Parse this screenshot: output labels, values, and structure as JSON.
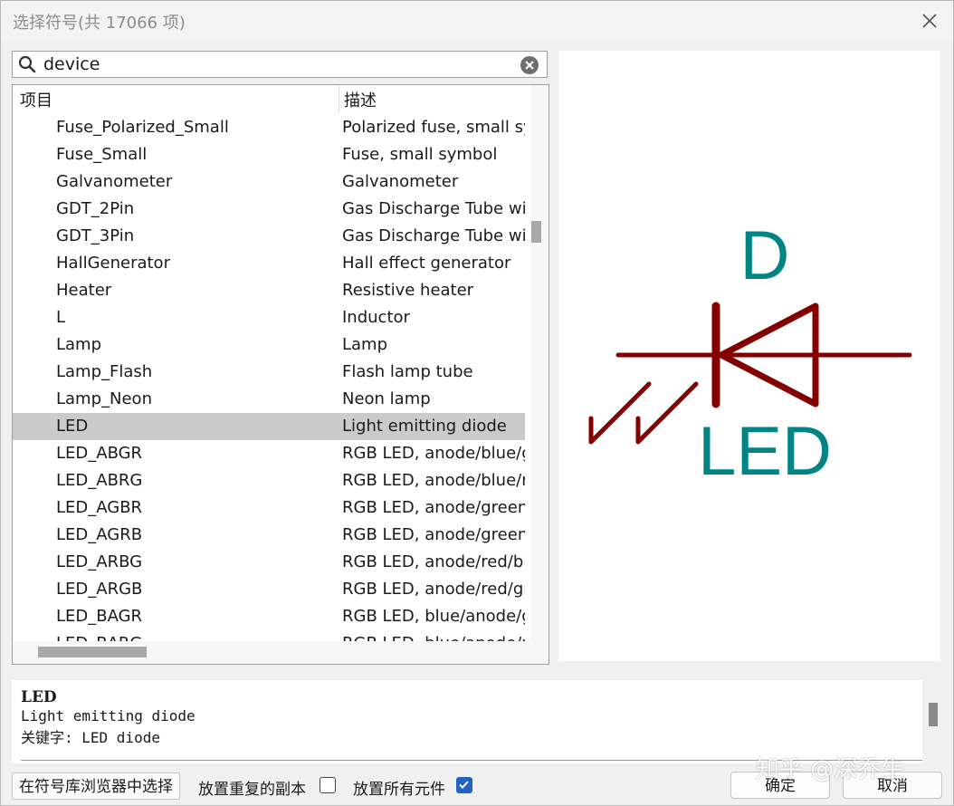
{
  "window": {
    "title": "选择符号(共 17066 项)",
    "close_icon": "close-icon"
  },
  "search": {
    "value": "device",
    "search_icon": "search-icon",
    "clear_icon": "clear-circle-icon"
  },
  "table": {
    "headers": [
      "项目",
      "描述"
    ],
    "rows": [
      {
        "name": "Fuse_Polarized_Small",
        "desc": "Polarized fuse, small syr"
      },
      {
        "name": "Fuse_Small",
        "desc": "Fuse, small symbol"
      },
      {
        "name": "Galvanometer",
        "desc": "Galvanometer"
      },
      {
        "name": "GDT_2Pin",
        "desc": "Gas Discharge Tube wit"
      },
      {
        "name": "GDT_3Pin",
        "desc": "Gas Discharge Tube wit"
      },
      {
        "name": "HallGenerator",
        "desc": "Hall effect generator"
      },
      {
        "name": "Heater",
        "desc": "Resistive heater"
      },
      {
        "name": "L",
        "desc": "Inductor"
      },
      {
        "name": "Lamp",
        "desc": "Lamp"
      },
      {
        "name": "Lamp_Flash",
        "desc": "Flash lamp tube"
      },
      {
        "name": "Lamp_Neon",
        "desc": "Neon lamp"
      },
      {
        "name": "LED",
        "desc": "Light emitting diode",
        "selected": true
      },
      {
        "name": "LED_ABGR",
        "desc": "RGB LED, anode/blue/g"
      },
      {
        "name": "LED_ABRG",
        "desc": "RGB LED, anode/blue/re"
      },
      {
        "name": "LED_AGBR",
        "desc": "RGB LED, anode/green/"
      },
      {
        "name": "LED_AGRB",
        "desc": "RGB LED, anode/green/"
      },
      {
        "name": "LED_ARBG",
        "desc": "RGB LED, anode/red/blu"
      },
      {
        "name": "LED_ARGB",
        "desc": "RGB LED, anode/red/gr"
      },
      {
        "name": "LED_BAGR",
        "desc": "RGB LED, blue/anode/g"
      },
      {
        "name": "LED_BARG",
        "desc": "RGB LED, blue/anode/r"
      }
    ]
  },
  "preview": {
    "reference": "D",
    "value": "LED",
    "symbol_color": "#840000",
    "text_color": "#008484"
  },
  "info": {
    "name": "LED",
    "description": "Light emitting diode",
    "keywords": "关键字: LED diode"
  },
  "footer": {
    "browse_button": "在符号库浏览器中选择",
    "place_repeated_label": "放置重复的副本",
    "place_repeated_checked": false,
    "place_all_units_label": "放置所有元件",
    "place_all_units_checked": true,
    "ok_button": "确定",
    "cancel_button": "取消",
    "watermark": "知乎 @深乔生"
  }
}
